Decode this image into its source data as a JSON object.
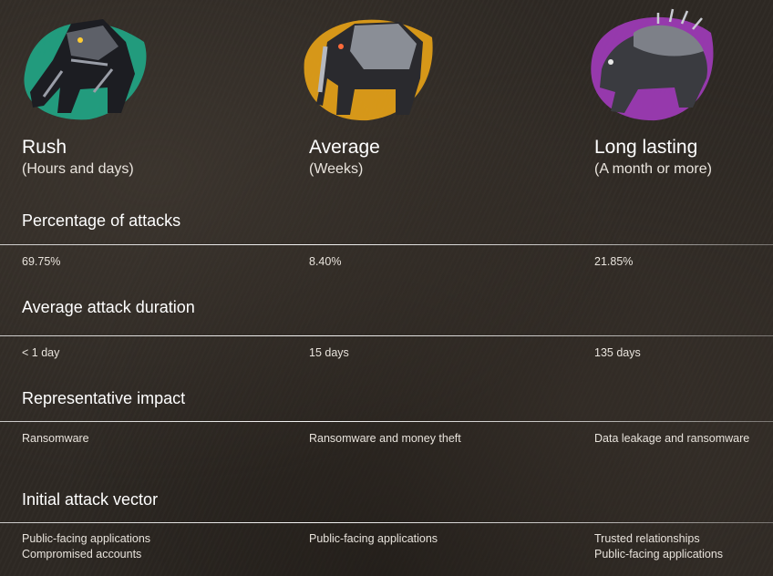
{
  "columns": [
    {
      "title": "Rush",
      "subtitle": "(Hours and days)",
      "art_icon": "robot-panther-icon",
      "accent_color": "#1fae8c"
    },
    {
      "title": "Average",
      "subtitle": "(Weeks)",
      "art_icon": "robot-elephant-icon",
      "accent_color": "#e8a317"
    },
    {
      "title": "Long lasting",
      "subtitle": "(A month or more)",
      "art_icon": "robot-turtle-icon",
      "accent_color": "#a83cc4"
    }
  ],
  "sections": [
    {
      "title": "Percentage of attacks",
      "values": [
        [
          "69.75%"
        ],
        [
          "8.40%"
        ],
        [
          "21.85%"
        ]
      ]
    },
    {
      "title": "Average attack duration",
      "values": [
        [
          "< 1 day"
        ],
        [
          "15 days"
        ],
        [
          "135 days"
        ]
      ]
    },
    {
      "title": "Representative impact",
      "values": [
        [
          "Ransomware"
        ],
        [
          "Ransomware and money theft"
        ],
        [
          "Data leakage and ransomware"
        ]
      ]
    },
    {
      "title": "Initial attack vector",
      "values": [
        [
          "Public-facing applications",
          "Compromised accounts"
        ],
        [
          "Public-facing applications"
        ],
        [
          "Trusted relationships",
          "Public-facing applications"
        ]
      ]
    }
  ]
}
